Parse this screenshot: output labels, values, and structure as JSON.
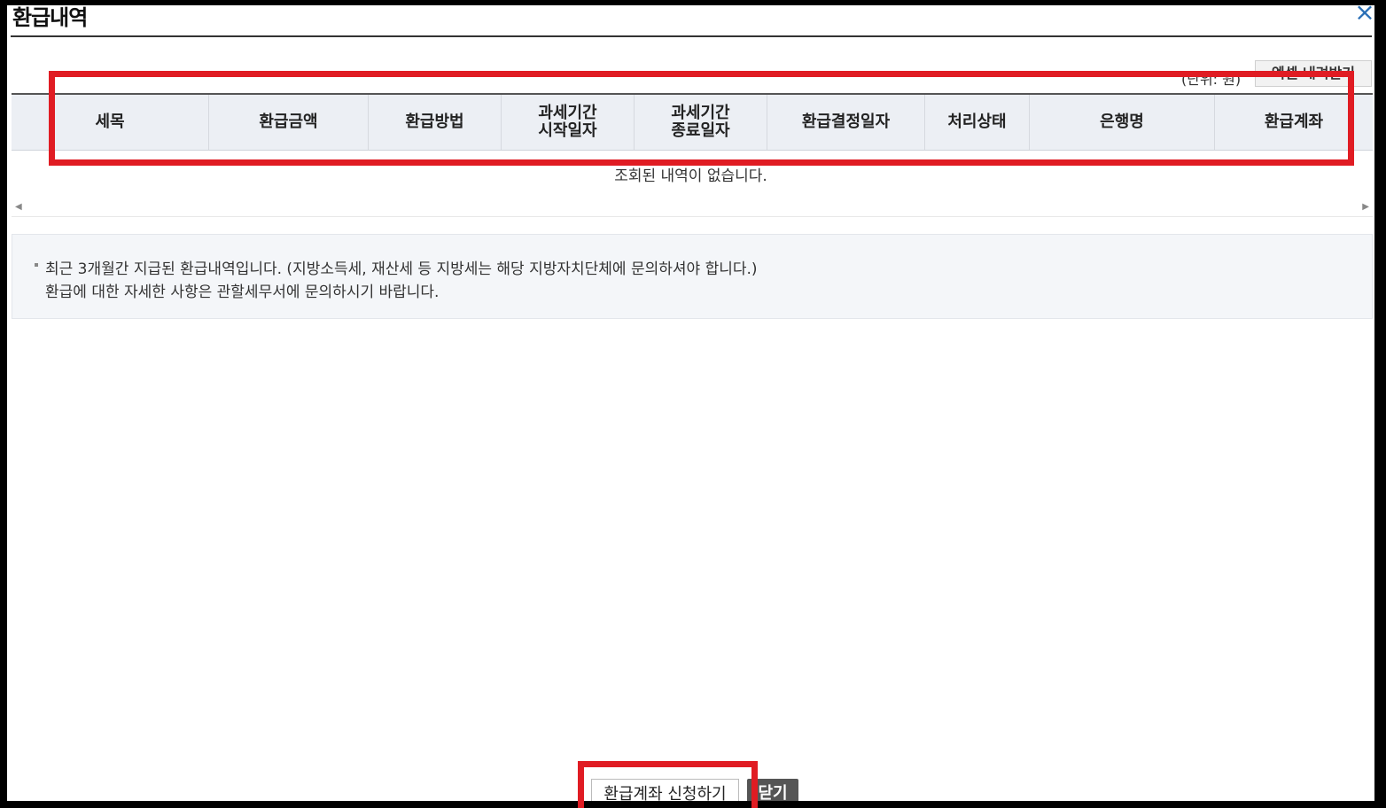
{
  "dialog": {
    "title": "환급내역",
    "close_icon": "×"
  },
  "toolbar": {
    "unit_label": "(단위: 원)",
    "excel_label": "엑셀 내려받기"
  },
  "table": {
    "headers": [
      "세목",
      "환급금액",
      "환급방법",
      "과세기간\n시작일자",
      "과세기간\n종료일자",
      "환급결정일자",
      "처리상태",
      "은행명",
      "환급계좌"
    ],
    "empty_message": "조회된 내역이 없습니다."
  },
  "scroll": {
    "left_arrow": "◀",
    "right_arrow": "▶"
  },
  "notice": {
    "line1": "최근 3개월간 지급된 환급내역입니다. (지방소득세, 재산세 등 지방세는 해당 지방자치단체에 문의하셔야 합니다.)",
    "line2": "환급에 대한 자세한 사항은 관할세무서에 문의하시기 바랍니다."
  },
  "footer": {
    "apply_label": "환급계좌 신청하기",
    "close_label": "닫기"
  },
  "colors": {
    "highlight": "#e01c23",
    "close_icon": "#2a6fb6"
  }
}
